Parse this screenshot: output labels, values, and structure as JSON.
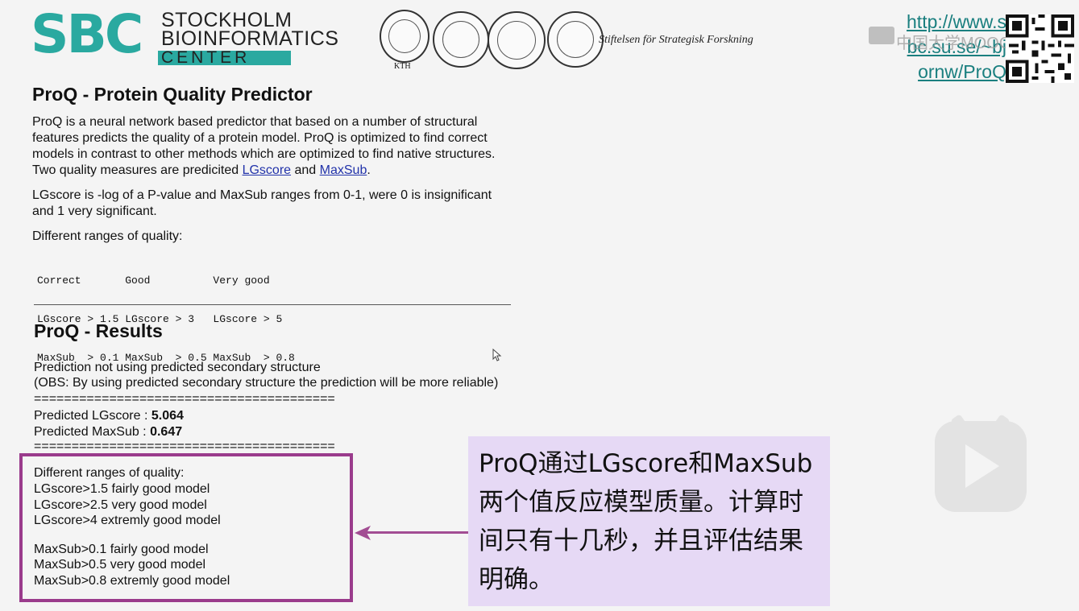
{
  "header": {
    "logo_letters": "SBC",
    "logo_line1": "STOCKHOLM",
    "logo_line2": "BIOINFORMATICS",
    "logo_line3": "CENTER",
    "seal_caption": "KTH",
    "foundation_text": "Stiftelsen för Strategisk Forskning",
    "link_text": [
      "http://www.s",
      "bc.su.se/~bj",
      "ornw/ProQ"
    ],
    "watermark_text": "中国大学MOOC",
    "qr_label": "qr-code"
  },
  "proq": {
    "title": "ProQ - Protein Quality Predictor",
    "desc_parts": [
      "ProQ is a neural network based predictor that based on a number of structural features predicts the quality of a protein model. ProQ is optimized to find correct models in contrast to other methods which are optimized to find native structures. Two quality measures are predicited ",
      " and ",
      "."
    ],
    "link_lgscore": "LGscore",
    "link_maxsub": "MaxSub",
    "desc2": "LGscore is -log of a P-value and MaxSub ranges from 0-1, were 0 is insignificant and 1 very significant.",
    "ranges_label": "Different ranges of quality:",
    "ranges_table": [
      "Correct       Good          Very good",
      "LGscore > 1.5 LGscore > 3   LGscore > 5",
      "MaxSub  > 0.1 MaxSub  > 0.5 MaxSub  > 0.8"
    ]
  },
  "results": {
    "title": "ProQ - Results",
    "line1": "Prediction not using predicted secondary structure",
    "line2": "(OBS: By using predicted secondary structure the prediction will be more reliable)",
    "separator": "========================================",
    "lgscore_label": "Predicted LGscore : ",
    "lgscore_value": "5.064",
    "maxsub_label": "Predicted MaxSub : ",
    "maxsub_value": "0.647",
    "quality_label": "Different ranges of quality:",
    "quality_lines_a": [
      "LGscore>1.5 fairly good model",
      "LGscore>2.5 very good model",
      "LGscore>4 extremly good model"
    ],
    "quality_lines_b": [
      "MaxSub>0.1 fairly good model",
      "MaxSub>0.5 very good model",
      "MaxSub>0.8 extremly good model"
    ]
  },
  "annotation": {
    "text": "ProQ通过LGscore和MaxSub两个值反应模型质量。计算时间只有十几秒，并且评估结果明确。",
    "border_color": "#9a3b8c",
    "callout_bg": "#e6d9f5"
  },
  "player": {
    "play_label": "play-button"
  }
}
